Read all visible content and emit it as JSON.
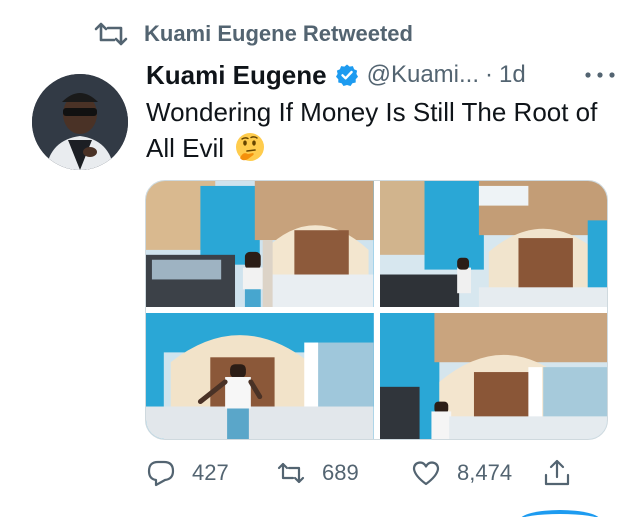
{
  "retweet": {
    "icon": "retweet-icon",
    "label": "Kuami Eugene Retweeted"
  },
  "tweet": {
    "author_name": "Kuami Eugene",
    "verified_icon": "verified-badge-icon",
    "handle": "@Kuami...",
    "separator": "·",
    "time": "1d",
    "more_icon": "more-options-icon",
    "text": "Wondering If Money Is Still The Root of All Evil",
    "emoji": "thinking-face-emoji"
  },
  "media": {
    "photos": [
      "photo-1",
      "photo-2",
      "photo-3",
      "photo-4"
    ]
  },
  "actions": {
    "reply_count": "427",
    "retweet_count": "689",
    "like_count": "8,474",
    "reply_icon": "reply-icon",
    "retweet_icon": "retweet-icon",
    "like_icon": "heart-icon",
    "share_icon": "share-icon"
  },
  "colors": {
    "text_primary": "#0f1419",
    "text_secondary": "#536471",
    "accent": "#1d9bf0",
    "verified": "#1d9bf0"
  }
}
